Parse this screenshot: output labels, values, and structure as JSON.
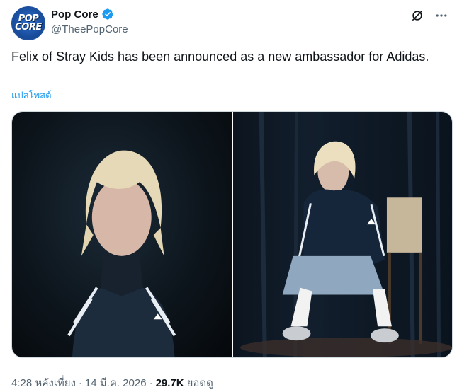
{
  "author": {
    "avatar_line1": "POP",
    "avatar_line2": "CORE",
    "display_name": "Pop Core",
    "handle": "@TheePopCore",
    "verified_color": "#1d9bf0"
  },
  "tweet": {
    "text": "Felix of Stray Kids has been announced as a new ambassador for Adidas.",
    "translate_label": "แปลโพสต์"
  },
  "icons": {
    "grok": "grok-icon",
    "more": "more-icon"
  },
  "media": {
    "count": 2
  },
  "meta": {
    "time": "4:28 หลังเที่ยง",
    "separator1": "·",
    "date": "14 มี.ค. 2026",
    "separator2": "·",
    "views_count": "29.7K",
    "views_label": "ยอดดู"
  }
}
